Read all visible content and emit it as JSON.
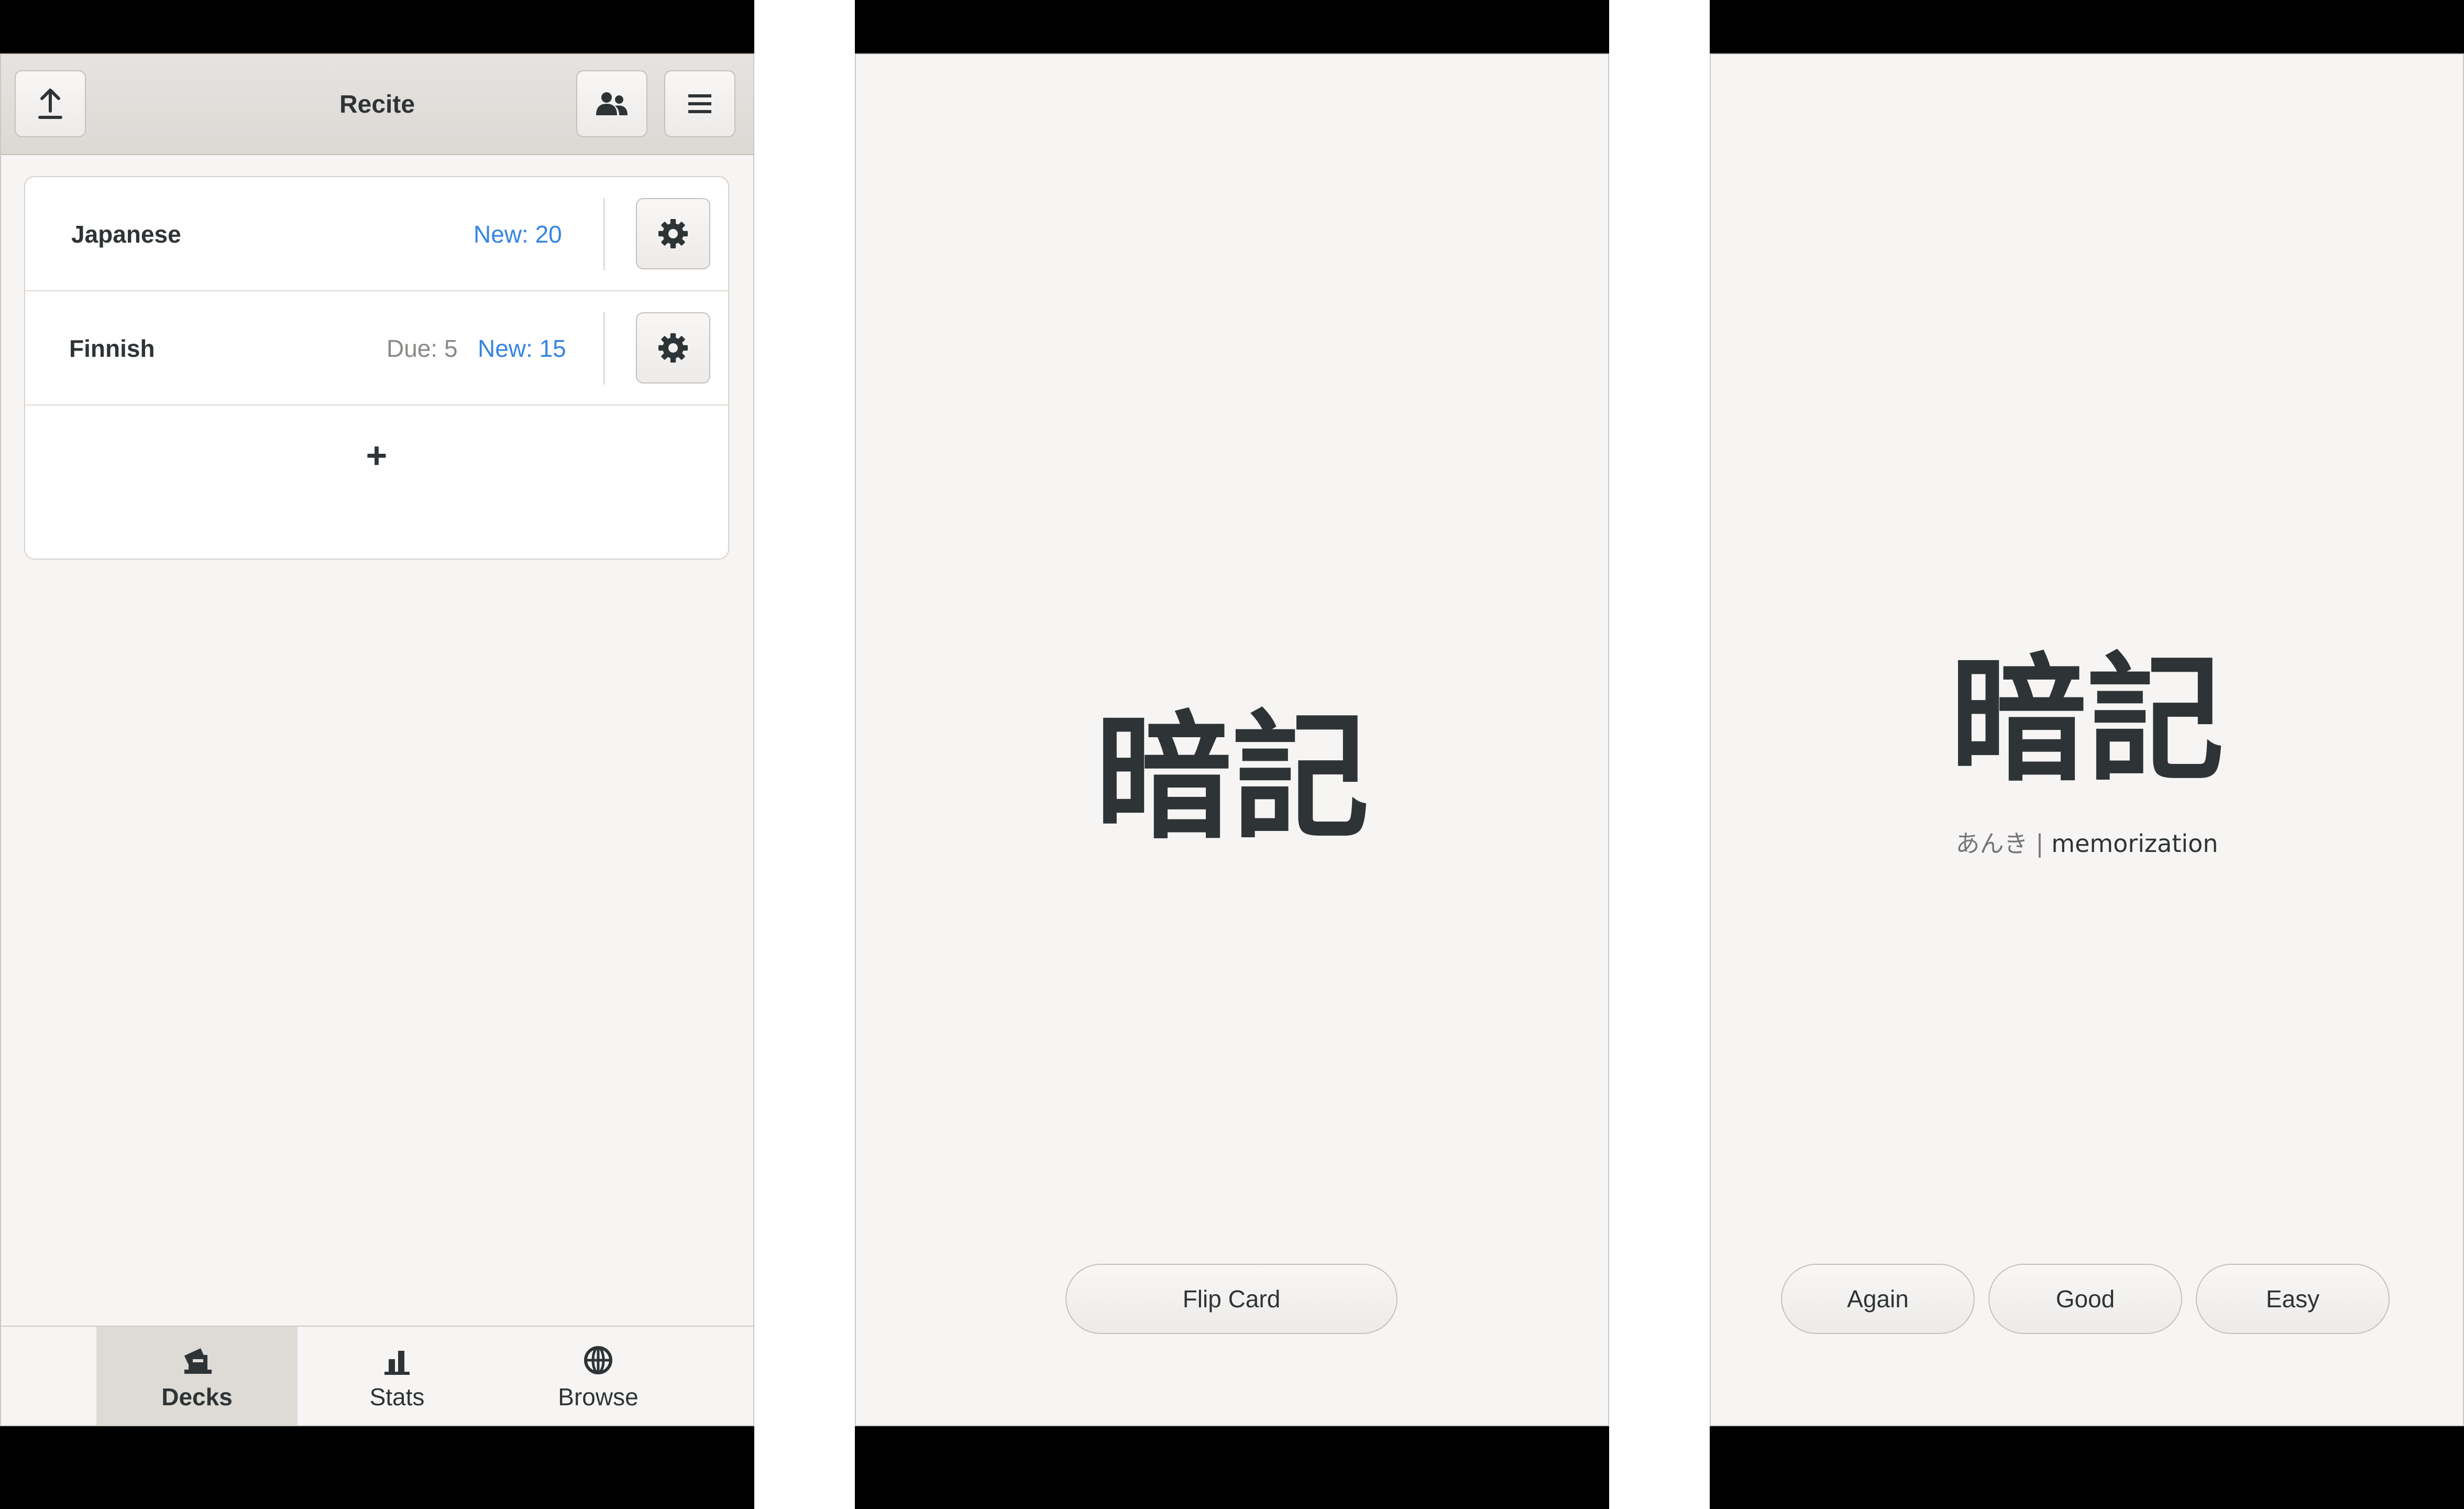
{
  "screens": {
    "decks": {
      "title": "Recite",
      "header_icons": {
        "upload": "upload-icon",
        "users": "people-icon",
        "menu": "hamburger-menu-icon"
      },
      "decks": [
        {
          "name": "Japanese",
          "due": "",
          "new": "New: 20"
        },
        {
          "name": "Finnish",
          "due": "Due: 5",
          "new": "New: 15"
        }
      ],
      "add_label": "+",
      "nav": [
        {
          "label": "Decks",
          "icon": "decks-icon",
          "active": true
        },
        {
          "label": "Stats",
          "icon": "stats-icon",
          "active": false
        },
        {
          "label": "Browse",
          "icon": "globe-icon",
          "active": false
        }
      ]
    },
    "card_front": {
      "word": "暗記",
      "flip_label": "Flip Card"
    },
    "card_back": {
      "word": "暗記",
      "reading": "あんき",
      "separator": "|",
      "meaning": "memorization",
      "buttons": [
        "Again",
        "Good",
        "Easy"
      ]
    }
  },
  "colors": {
    "accent_blue": "#3584e4",
    "text_dark": "#2e3436",
    "muted": "#888a85",
    "background": "#f6f5f4"
  }
}
